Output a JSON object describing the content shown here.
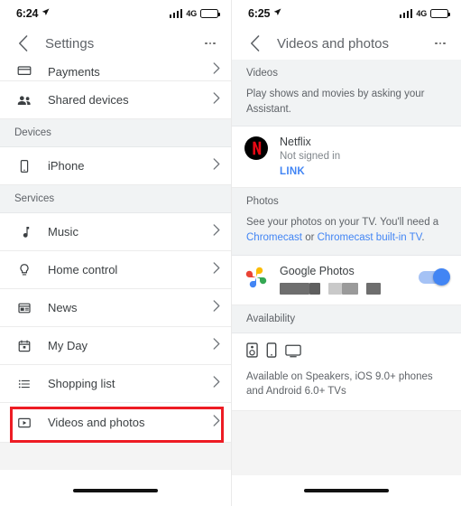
{
  "left": {
    "status_bar": {
      "time": "6:24",
      "location_icon": "location-arrow-icon",
      "network": "4G",
      "signal_icon": "signal-bars-icon",
      "battery_icon": "battery-icon"
    },
    "nav": {
      "back_icon": "chevron-left-icon",
      "title": "Settings",
      "more_icon": "overflow-menu-icon"
    },
    "items": [
      {
        "type": "row",
        "label": "Payments",
        "icon": "payment-card-icon",
        "clipped": true
      },
      {
        "type": "row",
        "label": "Shared devices",
        "icon": "people-icon"
      },
      {
        "type": "section",
        "label": "Devices"
      },
      {
        "type": "row",
        "label": "iPhone",
        "icon": "phone-icon"
      },
      {
        "type": "section",
        "label": "Services"
      },
      {
        "type": "row",
        "label": "Music",
        "icon": "music-note-icon"
      },
      {
        "type": "row",
        "label": "Home control",
        "icon": "lightbulb-icon"
      },
      {
        "type": "row",
        "label": "News",
        "icon": "news-icon"
      },
      {
        "type": "row",
        "label": "My Day",
        "icon": "calendar-icon"
      },
      {
        "type": "row",
        "label": "Shopping list",
        "icon": "list-icon"
      },
      {
        "type": "row",
        "label": "Videos and photos",
        "icon": "video-box-icon",
        "highlighted": true
      }
    ],
    "highlight_color": "#ed1c24"
  },
  "right": {
    "status_bar": {
      "time": "6:25",
      "location_icon": "location-arrow-icon",
      "network": "4G",
      "signal_icon": "signal-bars-icon",
      "battery_icon": "battery-icon"
    },
    "nav": {
      "back_icon": "chevron-left-icon",
      "title": "Videos and photos",
      "more_icon": "overflow-menu-icon"
    },
    "videos": {
      "header": "Videos",
      "description": "Play shows and movies by asking your Assistant."
    },
    "netflix": {
      "name": "Netflix",
      "status": "Not signed in",
      "link_label": "LINK",
      "logo": "netflix-logo",
      "logo_bg": "#000000",
      "logo_fg": "#e50914"
    },
    "photos": {
      "header": "Photos",
      "text_before": "See your photos on your TV. You'll need a ",
      "link1": "Chromecast",
      "text_mid": " or ",
      "link2": "Chromecast built-in TV",
      "text_after": ".",
      "link_color": "#4285f4"
    },
    "google_photos": {
      "name": "Google Photos",
      "logo": "google-photos-pinwheel-icon",
      "toggle_on": true,
      "toggle_color": "#4285f4",
      "redacted_blocks": [
        {
          "width": 33,
          "color": "#6e6e6e"
        },
        {
          "width": 12,
          "color": "#5f5f5f"
        },
        {
          "width": 15,
          "color": "#c9c9c9"
        },
        {
          "width": 18,
          "color": "#9a9a9a"
        },
        {
          "width": 16,
          "color": "#6e6e6e"
        }
      ]
    },
    "availability": {
      "header": "Availability",
      "icons": [
        "speaker-icon",
        "phone-icon",
        "tv-icon"
      ],
      "text": "Available on Speakers, iOS 9.0+ phones and Android 6.0+ TVs"
    }
  }
}
